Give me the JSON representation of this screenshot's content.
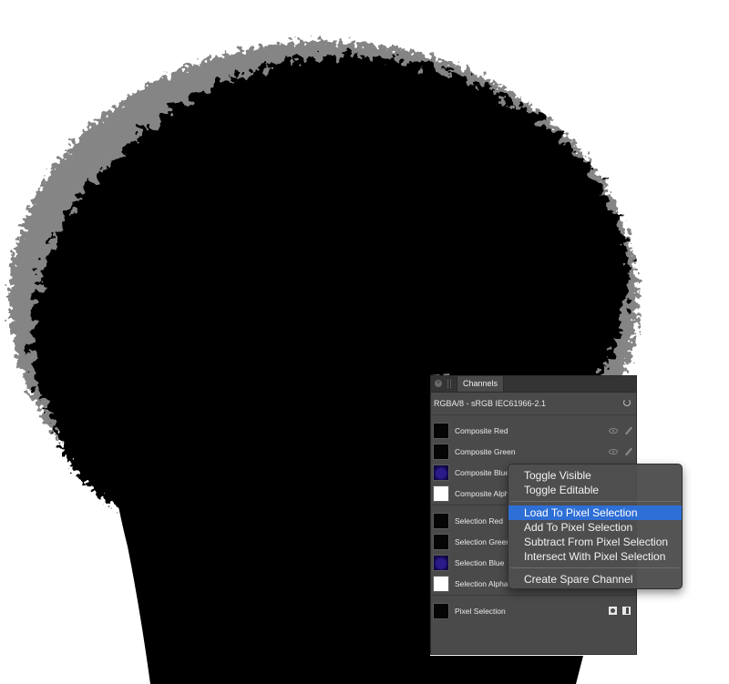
{
  "canvas": {
    "background": "#ffffff",
    "subject_color": "#000000"
  },
  "panel": {
    "tab_label": "Channels",
    "close_icon": "close-icon",
    "format_label": "RGBA/8 - sRGB IEC61966-2.1",
    "refresh_icon": "refresh-icon",
    "composite_rows": [
      {
        "label": "Composite Red",
        "thumb": "black",
        "show_controls": true
      },
      {
        "label": "Composite Green",
        "thumb": "black",
        "show_controls": true
      },
      {
        "label": "Composite Blue",
        "thumb": "blue",
        "show_controls": false
      },
      {
        "label": "Composite Alpha",
        "thumb": "white",
        "show_controls": false
      }
    ],
    "selection_rows": [
      {
        "label": "Selection Red",
        "thumb": "black"
      },
      {
        "label": "Selection Green",
        "thumb": "black"
      },
      {
        "label": "Selection Blue",
        "thumb": "blue"
      },
      {
        "label": "Selection Alpha",
        "thumb": "white"
      }
    ],
    "pixel_selection_label": "Pixel Selection"
  },
  "context_menu": {
    "group1": [
      "Toggle Visible",
      "Toggle Editable"
    ],
    "group2": [
      "Load To Pixel Selection",
      "Add To Pixel Selection",
      "Subtract From Pixel Selection",
      "Intersect With Pixel Selection"
    ],
    "group3": [
      "Create Spare Channel"
    ],
    "highlighted": "Load To Pixel Selection",
    "highlight_color": "#2e6fd6"
  }
}
